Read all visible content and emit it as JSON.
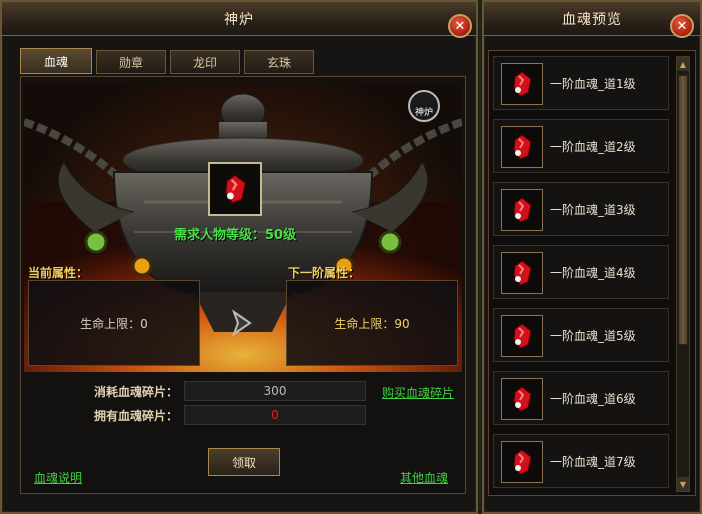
{
  "main_window": {
    "title": "神炉",
    "tabs": [
      {
        "label": "血魂",
        "active": true
      },
      {
        "label": "勋章",
        "active": false
      },
      {
        "label": "龙印",
        "active": false
      },
      {
        "label": "玄珠",
        "active": false
      }
    ],
    "furnace_badge": "神炉",
    "requirement": "需求人物等级：50级",
    "current_attr_title": "当前属性：",
    "next_attr_title": "下一阶属性：",
    "current_attr": "生命上限：0",
    "next_attr": "生命上限：90",
    "consume_label": "消耗血魂碎片：",
    "consume_value": "300",
    "own_label": "拥有血魂碎片：",
    "own_value": "0",
    "buy_link": "购买血魂碎片",
    "claim_button": "领取",
    "help_link": "血魂说明",
    "other_link": "其他血魂"
  },
  "preview_window": {
    "title": "血魂预览",
    "items": [
      {
        "name": "一阶血魂_道1级"
      },
      {
        "name": "一阶血魂_道2级"
      },
      {
        "name": "一阶血魂_道3级"
      },
      {
        "name": "一阶血魂_道4级"
      },
      {
        "name": "一阶血魂_道5级"
      },
      {
        "name": "一阶血魂_道6级"
      },
      {
        "name": "一阶血魂_道7级"
      }
    ]
  },
  "icons": {
    "close": "close-icon",
    "item": "blood-soul-gem-icon",
    "scroll_up": "arrow-up-icon",
    "scroll_down": "arrow-down-icon",
    "upgrade_arrow": "arrow-right-icon"
  },
  "colors": {
    "frame": "#6a5536",
    "requirement_text": "#48e048",
    "attr_title": "#f2d060",
    "link": "#40d040",
    "own_value": "#e02020"
  }
}
